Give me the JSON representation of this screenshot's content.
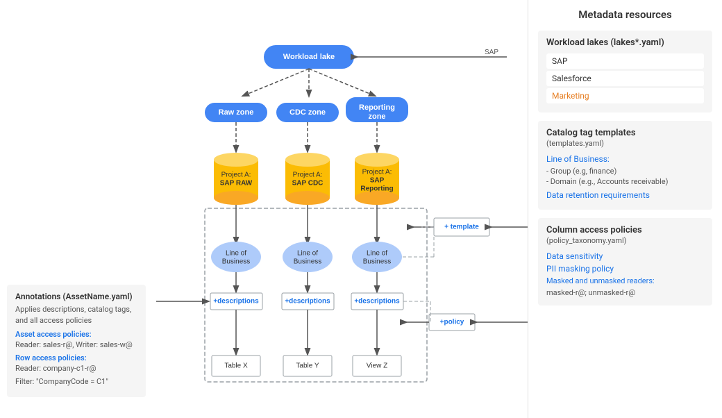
{
  "right_panel": {
    "title": "Metadata resources",
    "workload_section": {
      "title": "Workload lakes (lakes*.yaml)",
      "items": [
        {
          "label": "SAP",
          "style": "normal"
        },
        {
          "label": "Salesforce",
          "style": "normal"
        },
        {
          "label": "Marketing",
          "style": "orange"
        }
      ]
    },
    "catalog_section": {
      "title": "Catalog tag templates",
      "subtitle": "(templates.yaml)",
      "link": "Line of Business:",
      "items": [
        "- Group (e.g, finance)",
        "- Domain (e.g., Accounts receivable)"
      ],
      "link2": "Data retention requirements"
    },
    "column_section": {
      "title": "Column access policies",
      "subtitle": "(policy_taxonomy.yaml)",
      "link1": "Data sensitivity",
      "link2": "PII masking policy",
      "link3": "Masked and unmasked readers:",
      "value": "masked-r@; unmasked-r@"
    }
  },
  "annotation_box": {
    "title": "Annotations (AssetName.yaml)",
    "desc": "Applies descriptions, catalog tags, and all access policies",
    "asset_label": "Asset access policies:",
    "asset_value": "Reader: sales-r@, Writer: sales-w@",
    "row_label": "Row access policies:",
    "row_value": "Reader: company-c1-r@",
    "filter_label": "Filter:",
    "filter_value": "\"CompanyCode = C1\""
  },
  "diagram": {
    "workload_lake": "Workload lake",
    "raw_zone": "Raw zone",
    "cdc_zone": "CDC zone",
    "reporting_zone": "Reporting zone",
    "project_a_raw": "Project A:\nSAP RAW",
    "project_a_cdc": "Project A:\nSAP CDC",
    "project_a_reporting": "Project A:\nSAP Reporting",
    "line_of_business": "Line of\nBusiness",
    "descriptions": "+descriptions",
    "table_x": "Table X",
    "table_y": "Table Y",
    "view_z": "View Z",
    "template_label": "+ template",
    "policy_label": "+policy"
  }
}
